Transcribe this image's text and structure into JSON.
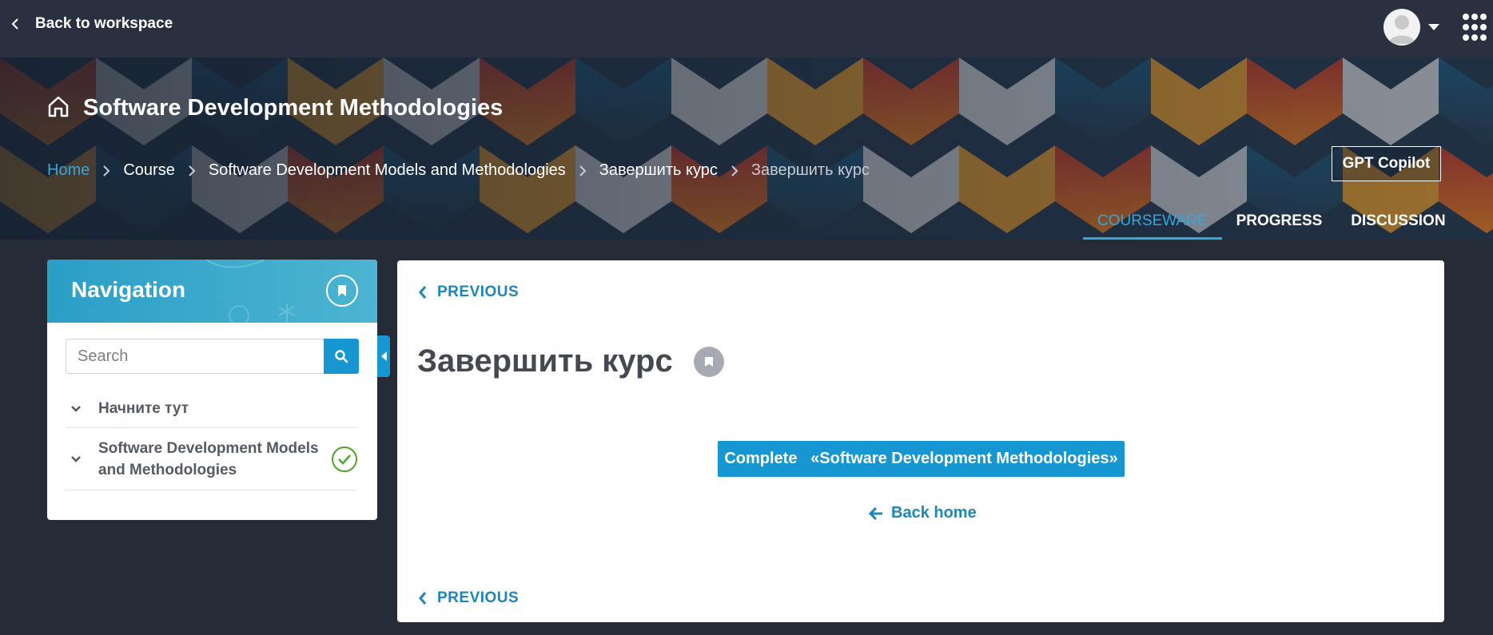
{
  "topbar": {
    "back_label": "Back to workspace"
  },
  "hero": {
    "course_title": "Software Development Methodologies",
    "breadcrumb": [
      "Home",
      "Course",
      "Software Development Models and Methodologies",
      "Завершить курс",
      "Завершить курс"
    ],
    "gpt_label": "GPT Copilot",
    "tabs": [
      "COURSEWARE",
      "PROGRESS",
      "DISCUSSION"
    ],
    "active_tab": "COURSEWARE"
  },
  "navigation": {
    "title": "Navigation",
    "search_placeholder": "Search",
    "items": [
      {
        "label": "Начните тут",
        "completed": false
      },
      {
        "label_line1": "Software Development Models",
        "label_line2": "and Methodologies",
        "completed": true
      }
    ]
  },
  "content": {
    "prev_label": "PREVIOUS",
    "unit_title": "Завершить курс",
    "complete_button": "Complete   «Software Development Methodologies»",
    "back_home": "Back home"
  },
  "colors": {
    "accent": "#1797d1",
    "link": "#1d86b9",
    "success": "#55a228",
    "page_bg": "#262b38",
    "topbar_bg": "#2b3040"
  },
  "icons": [
    "chevron-left-icon",
    "user-avatar-icon",
    "caret-down-icon",
    "apps-grid-icon",
    "home-icon",
    "chevron-right-icon",
    "bookmark-icon",
    "search-icon",
    "chevron-down-icon",
    "check-circle-icon",
    "arrow-left-icon"
  ]
}
